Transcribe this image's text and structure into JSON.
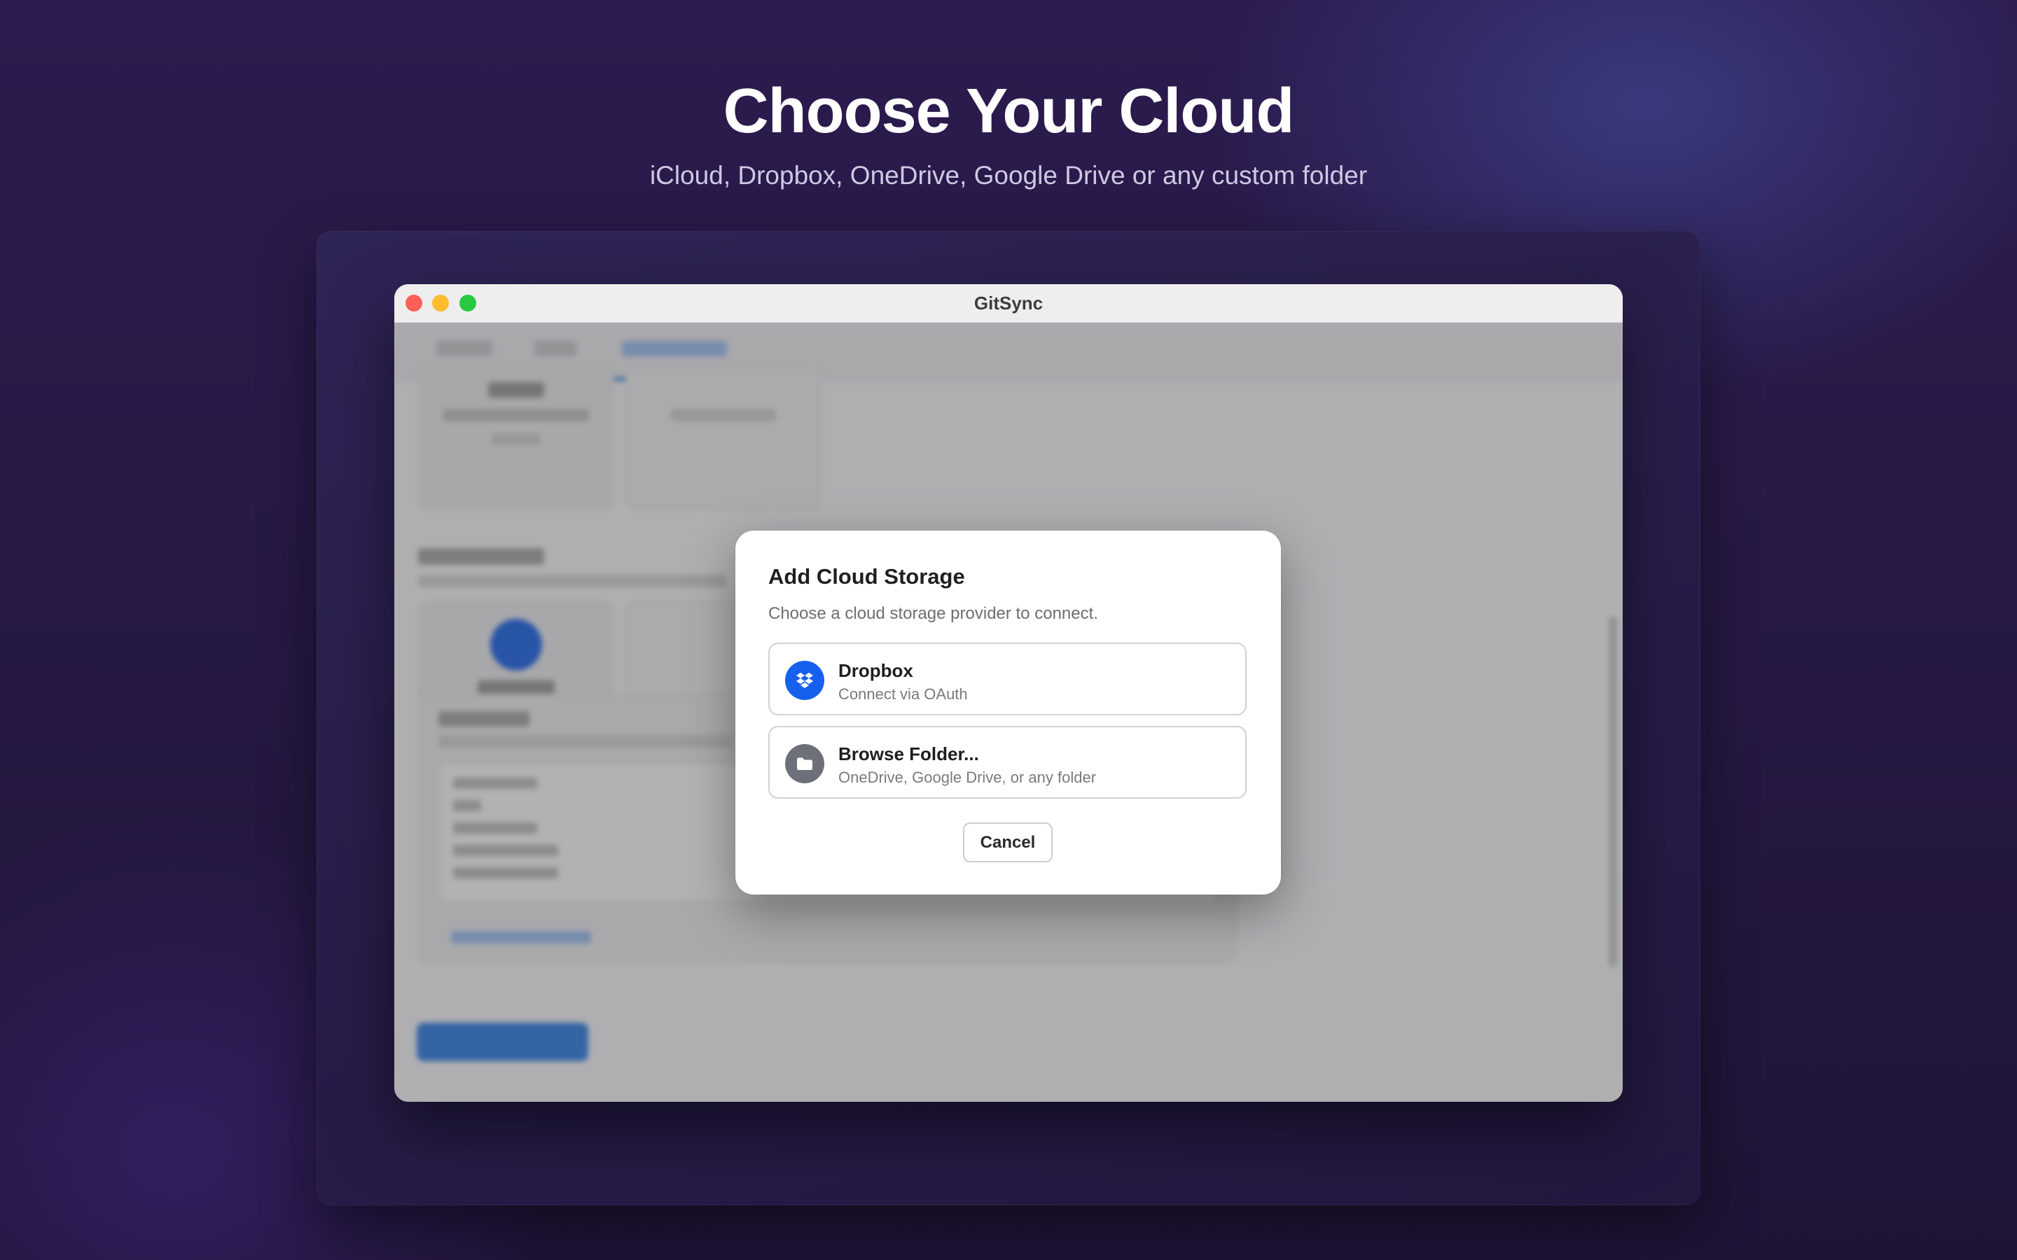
{
  "hero": {
    "title": "Choose Your Cloud",
    "subtitle": "iCloud, Dropbox, OneDrive, Google Drive or any custom folder"
  },
  "window": {
    "title": "GitSync",
    "traffic_lights": {
      "close": "#fe5f57",
      "minimize": "#febc2e",
      "maximize": "#28c840"
    }
  },
  "dialog": {
    "title": "Add Cloud Storage",
    "subtitle": "Choose a cloud storage provider to connect.",
    "providers": [
      {
        "name": "Dropbox",
        "description": "Connect via OAuth",
        "icon": "dropbox-icon",
        "icon_color": "#1760ee"
      },
      {
        "name": "Browse Folder...",
        "description": "OneDrive, Google Drive, or any folder",
        "icon": "folder-icon",
        "icon_color": "#6e7079"
      }
    ],
    "cancel_label": "Cancel"
  },
  "colors": {
    "accent": "#2f7de1",
    "background": "#2c1b4e"
  }
}
